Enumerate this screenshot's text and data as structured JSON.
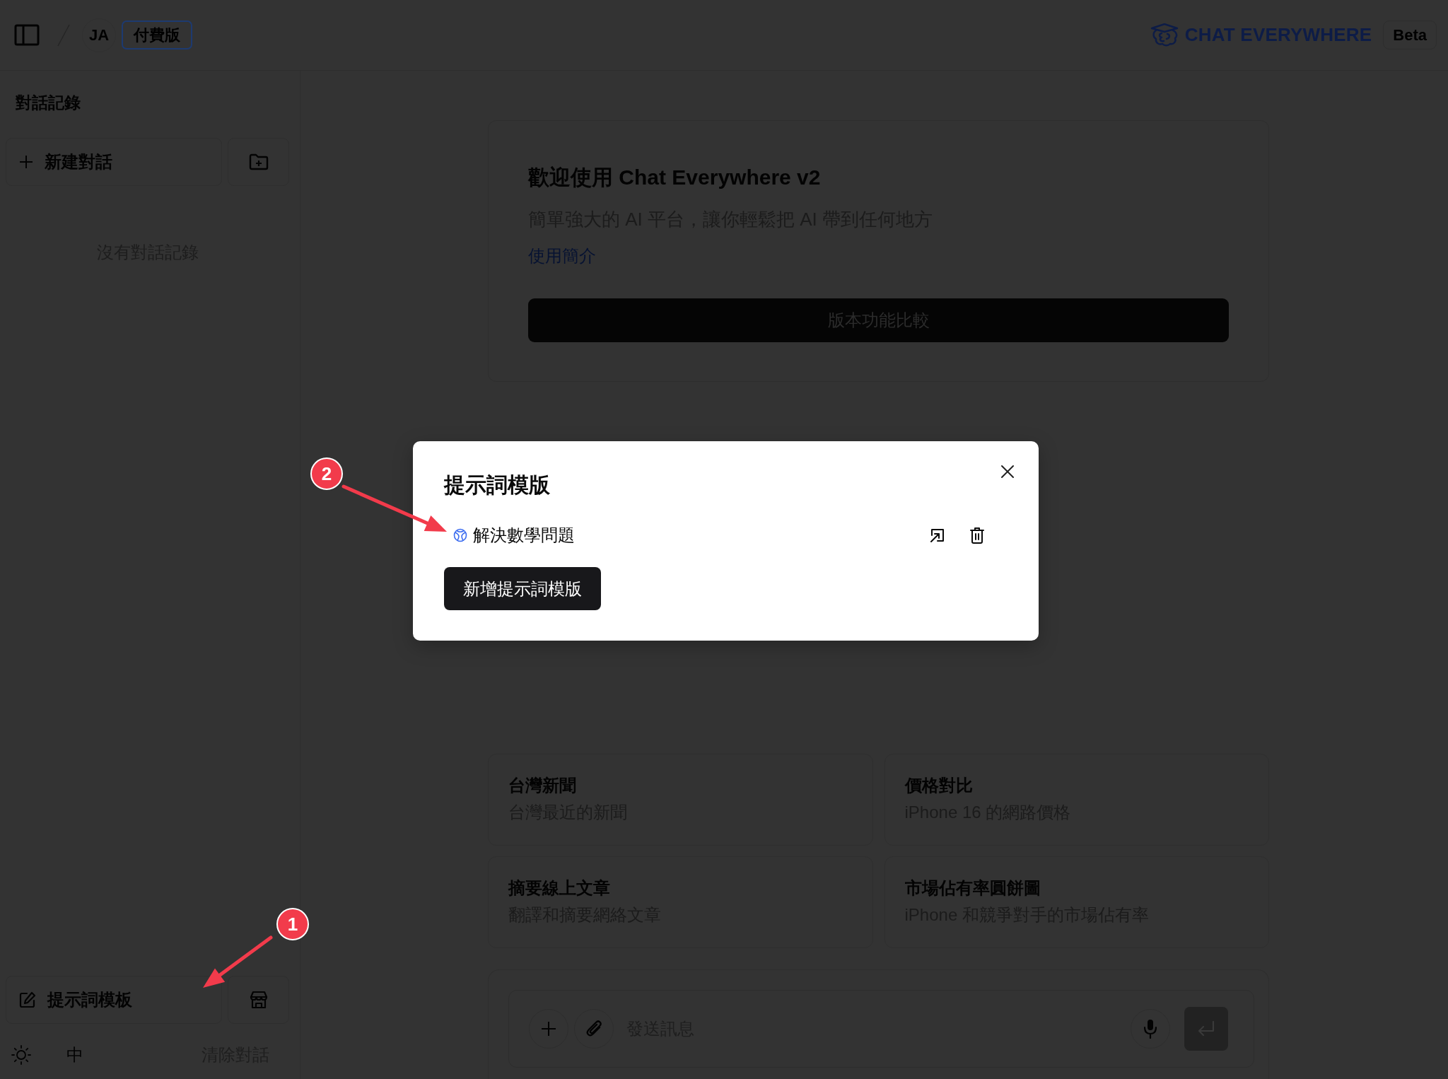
{
  "top_bar": {
    "user_initials": "JA",
    "plan_badge": "付費版",
    "brand": "CHAT EVERYWHERE",
    "beta_badge": "Beta"
  },
  "sidebar": {
    "title": "對話記錄",
    "new_chat_button": "新建對話",
    "empty_message": "沒有對話記錄",
    "prompt_button": "提示詞模板",
    "language_button": "中",
    "clear_button": "清除對話"
  },
  "welcome_card": {
    "title": "歡迎使用 Chat Everywhere v2",
    "subtitle": "簡單強大的 AI 平台，讓你輕鬆把 AI 帶到任何地方",
    "link": "使用簡介",
    "button": "版本功能比較"
  },
  "suggestions": [
    {
      "title": "台灣新聞",
      "description": "台灣最近的新聞"
    },
    {
      "title": "價格對比",
      "description": "iPhone 16 的網路價格"
    },
    {
      "title": "摘要線上文章",
      "description": "翻譯和摘要網絡文章"
    },
    {
      "title": "市場佔有率圓餅圖",
      "description": "iPhone 和競爭對手的市場佔有率"
    }
  ],
  "composer": {
    "placeholder": "發送訊息",
    "send_disabled": true
  },
  "modal": {
    "title": "提示詞模版",
    "prompts": [
      {
        "name": "解決數學問題"
      }
    ],
    "add_button": "新增提示詞模版"
  },
  "annotations": [
    {
      "number": "1"
    },
    {
      "number": "2"
    }
  ]
}
